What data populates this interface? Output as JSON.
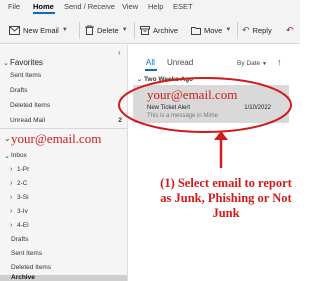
{
  "menu": {
    "items": [
      "File",
      "Home",
      "Send / Receive",
      "View",
      "Help",
      "ESET"
    ],
    "active": "Home"
  },
  "ribbon": {
    "new_email": "New Email",
    "delete": "Delete",
    "archive": "Archive",
    "move": "Move",
    "reply": "Reply"
  },
  "folders": {
    "favorites_header": "Favorites",
    "favorites": [
      {
        "label": "Sent Items",
        "count": ""
      },
      {
        "label": "Drafts",
        "count": ""
      },
      {
        "label": "Deleted Items",
        "count": ""
      },
      {
        "label": "Unread Mail",
        "count": "2"
      }
    ],
    "account": "your@email.com",
    "inbox": "Inbox",
    "subfolders": [
      "1-Pr",
      "2-C",
      "3-Si",
      "3-Iv",
      "4-El"
    ],
    "other": [
      "Drafts",
      "Sent Items",
      "Deleted Items",
      "Archive"
    ],
    "selected": "Archive"
  },
  "message_list": {
    "tab_all": "All",
    "tab_unread": "Unread",
    "sort": "By Date",
    "group_header": "Two Weeks Ago",
    "messages": [
      {
        "sender": "your@email.com",
        "subject": "New Ticket Alert",
        "date": "1/10/2022",
        "preview": "This is a message in Mime"
      }
    ]
  },
  "annotation": {
    "text": "(1) Select email to report as Junk, Phishing or Not Junk",
    "color": "#d11a1a"
  },
  "colors": {
    "accent": "#0f6cbd",
    "selection": "#d9d9d9",
    "annotation": "#d11a1a"
  }
}
